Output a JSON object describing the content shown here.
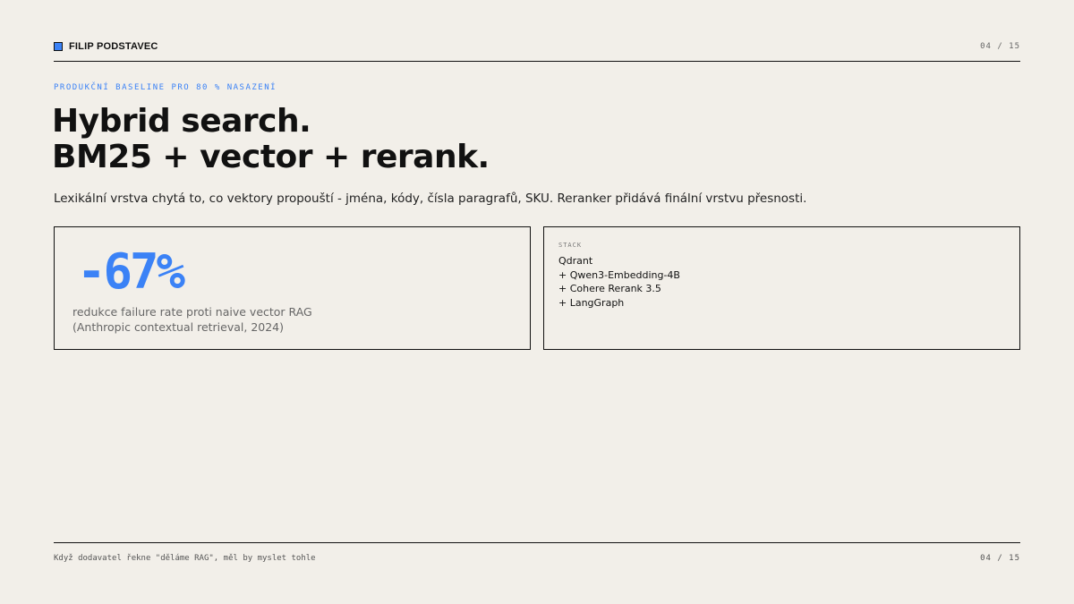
{
  "header": {
    "brand": "FILIP PODSTAVEC",
    "page": "04 / 15"
  },
  "slide": {
    "eyebrow": "PRODUKČNÍ BASELINE PRO 80 % NASAZENÍ",
    "title_line1": "Hybrid search.",
    "title_line2": "BM25 + vector + rerank.",
    "subtitle": "Lexikální vrstva chytá to, co vektory propouští - jména, kódy, čísla paragrafů, SKU. Reranker přidává finální vrstvu přesnosti."
  },
  "stat_card": {
    "value": "-67%",
    "caption_line1": "redukce failure rate proti naive vector RAG",
    "caption_line2": "(Anthropic contextual retrieval, 2024)"
  },
  "stack_card": {
    "label": "STACK",
    "items": [
      "Qdrant",
      "+ Qwen3-Embedding-4B",
      "+ Cohere Rerank 3.5",
      "+ LangGraph"
    ]
  },
  "footer": {
    "text": "Když dodavatel řekne \"děláme RAG\", měl by myslet tohle",
    "page": "04 / 15"
  },
  "colors": {
    "accent": "#3b82f6",
    "background": "#f2efe9",
    "ink": "#111111"
  }
}
